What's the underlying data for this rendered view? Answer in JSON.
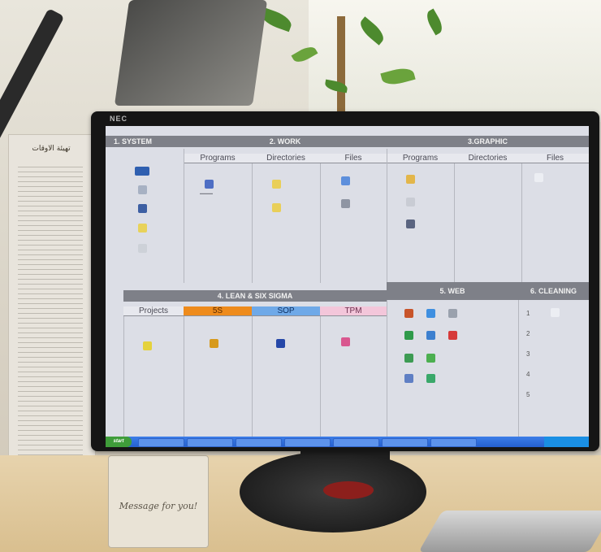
{
  "monitor": {
    "brand": "NEC"
  },
  "paper": {
    "header": "تهيئة الاوقات"
  },
  "card": {
    "text": "Message for you!"
  },
  "desktop": {
    "sections": [
      {
        "title": "1. SYSTEM"
      },
      {
        "title": "2. WORK",
        "columns": [
          "Programs",
          "Directories",
          "Files"
        ]
      },
      {
        "title": "3.GRAPHIC",
        "columns": [
          "Programs",
          "Directories",
          "Files"
        ]
      },
      {
        "title": "4. LEAN & SIX SIGMA",
        "columns": [
          "Projects",
          "5S",
          "SOP",
          "TPM"
        ]
      },
      {
        "title": "5. WEB"
      },
      {
        "title": "6. CLEANING",
        "numbers": [
          "1",
          "2",
          "3",
          "4",
          "5"
        ]
      }
    ],
    "colors": {
      "header_bar": "#7e8088",
      "five_s": "#ee8b1c",
      "sop": "#6fa9e8",
      "tpm": "#f3c6da",
      "taskbar": "#245fcf",
      "start": "#3f9d3a"
    },
    "taskbar": {
      "start_label": "start"
    }
  }
}
